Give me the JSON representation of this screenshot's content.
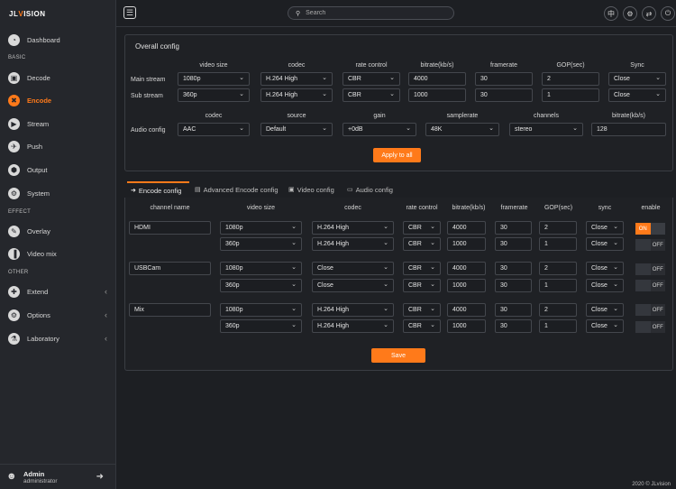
{
  "app": {
    "logo_left": "JL",
    "logo_mid": "V",
    "logo_right": "ISION"
  },
  "sidebar": {
    "items": [
      {
        "label": "Dashboard",
        "icon": "dashboard-icon",
        "glyph": "◔"
      },
      {
        "label": "Decode",
        "icon": "image-icon",
        "glyph": "▣"
      },
      {
        "label": "Encode",
        "icon": "encode-icon",
        "glyph": "✖"
      },
      {
        "label": "Stream",
        "icon": "stream-icon",
        "glyph": "▶"
      },
      {
        "label": "Push",
        "icon": "push-icon",
        "glyph": "✈"
      },
      {
        "label": "Output",
        "icon": "output-icon",
        "glyph": "⬢"
      },
      {
        "label": "System",
        "icon": "gear-icon",
        "glyph": "⚙"
      },
      {
        "label": "Overlay",
        "icon": "overlay-icon",
        "glyph": "✎"
      },
      {
        "label": "Video mix",
        "icon": "chart-icon",
        "glyph": "▐"
      },
      {
        "label": "Extend",
        "icon": "puzzle-icon",
        "glyph": "✚"
      },
      {
        "label": "Options",
        "icon": "options-icon",
        "glyph": "⚙"
      },
      {
        "label": "Laboratory",
        "icon": "flask-icon",
        "glyph": "⚗"
      }
    ],
    "sections": {
      "basic": "BASIC",
      "effect": "EFFECT",
      "other": "OTHER"
    },
    "user": {
      "name": "Admin",
      "role": "administrator"
    }
  },
  "topbar": {
    "search_placeholder": "Search",
    "lang_glyph": "中"
  },
  "overall": {
    "title": "Overall config",
    "headers": [
      "video size",
      "codec",
      "rate control",
      "bitrate(kb/s)",
      "framerate",
      "GOP(sec)",
      "Sync"
    ],
    "main": {
      "label": "Main stream",
      "size": "1080p",
      "codec": "H.264 High",
      "rc": "CBR",
      "bitrate": "4000",
      "fps": "30",
      "gop": "2",
      "sync": "Close"
    },
    "sub": {
      "label": "Sub stream",
      "size": "360p",
      "codec": "H.264 High",
      "rc": "CBR",
      "bitrate": "1000",
      "fps": "30",
      "gop": "1",
      "sync": "Close"
    },
    "audio_headers": [
      "codec",
      "source",
      "gain",
      "samplerate",
      "channels",
      "bitrate(kb/s)"
    ],
    "audio": {
      "label": "Audio config",
      "codec": "AAC",
      "source": "Default",
      "gain": "+0dB",
      "samplerate": "48K",
      "channels": "stereo",
      "bitrate": "128"
    },
    "apply_label": "Apply to all"
  },
  "tabs": [
    "Encode config",
    "Advanced Encode config",
    "Video config",
    "Audio config"
  ],
  "encode": {
    "headers": [
      "channel name",
      "video size",
      "codec",
      "rate control",
      "bitrate(kb/s)",
      "framerate",
      "GOP(sec)",
      "sync",
      "enable"
    ],
    "channels": [
      {
        "name": "HDMI",
        "rows": [
          {
            "size": "1080p",
            "codec": "H.264 High",
            "rc": "CBR",
            "bitrate": "4000",
            "fps": "30",
            "gop": "2",
            "sync": "Close",
            "toggle": "ON"
          },
          {
            "size": "360p",
            "codec": "H.264 High",
            "rc": "CBR",
            "bitrate": "1000",
            "fps": "30",
            "gop": "1",
            "sync": "Close",
            "toggle": "OFF"
          }
        ]
      },
      {
        "name": "USBCam",
        "rows": [
          {
            "size": "1080p",
            "codec": "Close",
            "rc": "CBR",
            "bitrate": "4000",
            "fps": "30",
            "gop": "2",
            "sync": "Close",
            "toggle": "OFF"
          },
          {
            "size": "360p",
            "codec": "Close",
            "rc": "CBR",
            "bitrate": "1000",
            "fps": "30",
            "gop": "1",
            "sync": "Close",
            "toggle": "OFF"
          }
        ]
      },
      {
        "name": "Mix",
        "rows": [
          {
            "size": "1080p",
            "codec": "H.264 High",
            "rc": "CBR",
            "bitrate": "4000",
            "fps": "30",
            "gop": "2",
            "sync": "Close",
            "toggle": "OFF"
          },
          {
            "size": "360p",
            "codec": "H.264 High",
            "rc": "CBR",
            "bitrate": "1000",
            "fps": "30",
            "gop": "1",
            "sync": "Close",
            "toggle": "OFF"
          }
        ]
      }
    ],
    "save_label": "Save"
  },
  "footer": {
    "copyright": "2020 © JLvision"
  },
  "colors": {
    "accent": "#ff7a1a",
    "background": "#1d1f23",
    "panel": "#1f2125"
  }
}
